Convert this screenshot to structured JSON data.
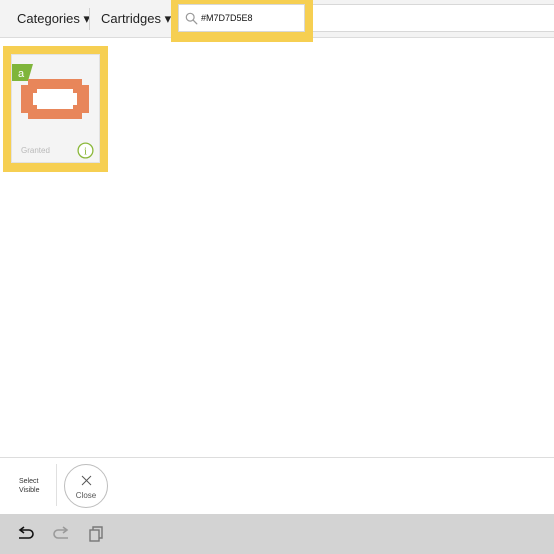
{
  "nav": {
    "categories_label": "Categories ▾",
    "cartridges_label": "Cartridges ▾"
  },
  "search": {
    "value": "#M7D7D5E8",
    "icon": "search-icon"
  },
  "tile": {
    "badge_text": "a",
    "status": "Granted",
    "info_icon_text": "i",
    "shape_fill": "#e8865a",
    "badge_color": "#7fb53b"
  },
  "action_bar": {
    "select_visible_label": "Select Visible",
    "close_label": "Close"
  },
  "system_bar": {
    "icons": [
      "back-icon",
      "forward-icon",
      "recent-apps-icon"
    ]
  },
  "colors": {
    "highlight": "#f6cf52",
    "info_green": "#8bb83a"
  }
}
